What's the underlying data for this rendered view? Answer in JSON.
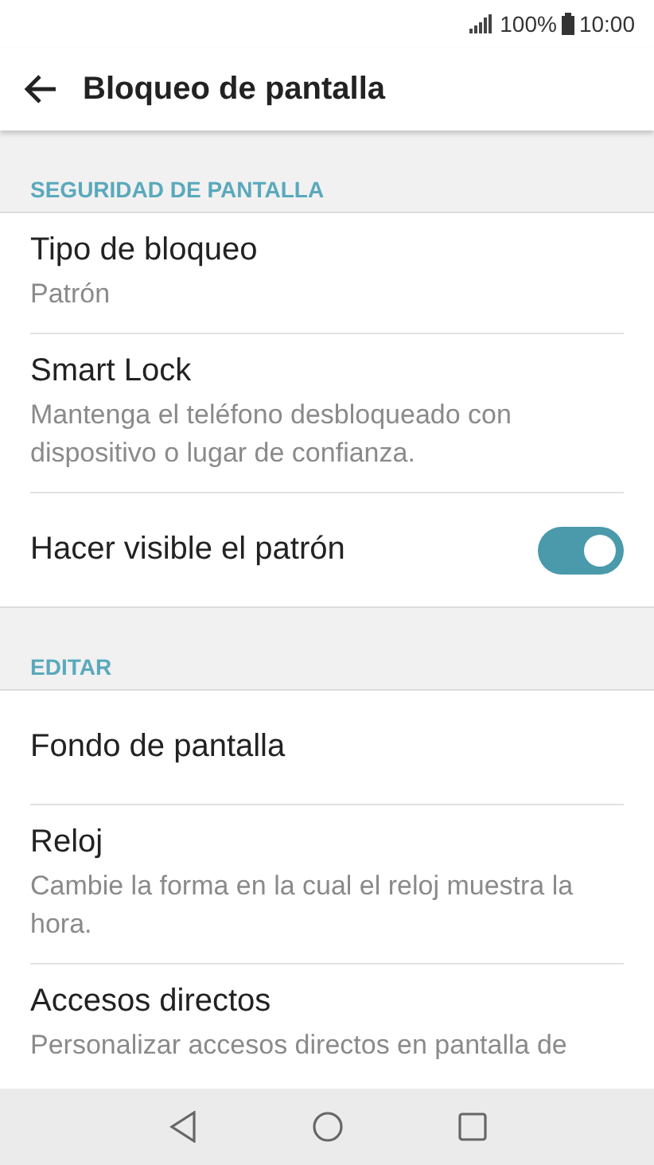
{
  "status_bar": {
    "battery": "100%",
    "time": "10:00"
  },
  "app_bar": {
    "title": "Bloqueo de pantalla"
  },
  "sections": [
    {
      "header": "SEGURIDAD DE PANTALLA",
      "items": [
        {
          "kind": "text",
          "title": "Tipo de bloqueo",
          "summary": "Patrón"
        },
        {
          "kind": "text",
          "title": "Smart Lock",
          "summary": "Mantenga el teléfono desbloqueado con dispositivo o lugar de confianza."
        },
        {
          "kind": "switch",
          "title": "Hacer visible el patrón",
          "on": true
        }
      ]
    },
    {
      "header": "EDITAR",
      "items": [
        {
          "kind": "text",
          "title": "Fondo de pantalla"
        },
        {
          "kind": "text",
          "title": "Reloj",
          "summary": "Cambie la forma en la cual el reloj muestra la hora."
        },
        {
          "kind": "text",
          "title": "Accesos directos",
          "summary": "Personalizar accesos directos en pantalla de"
        }
      ]
    }
  ]
}
